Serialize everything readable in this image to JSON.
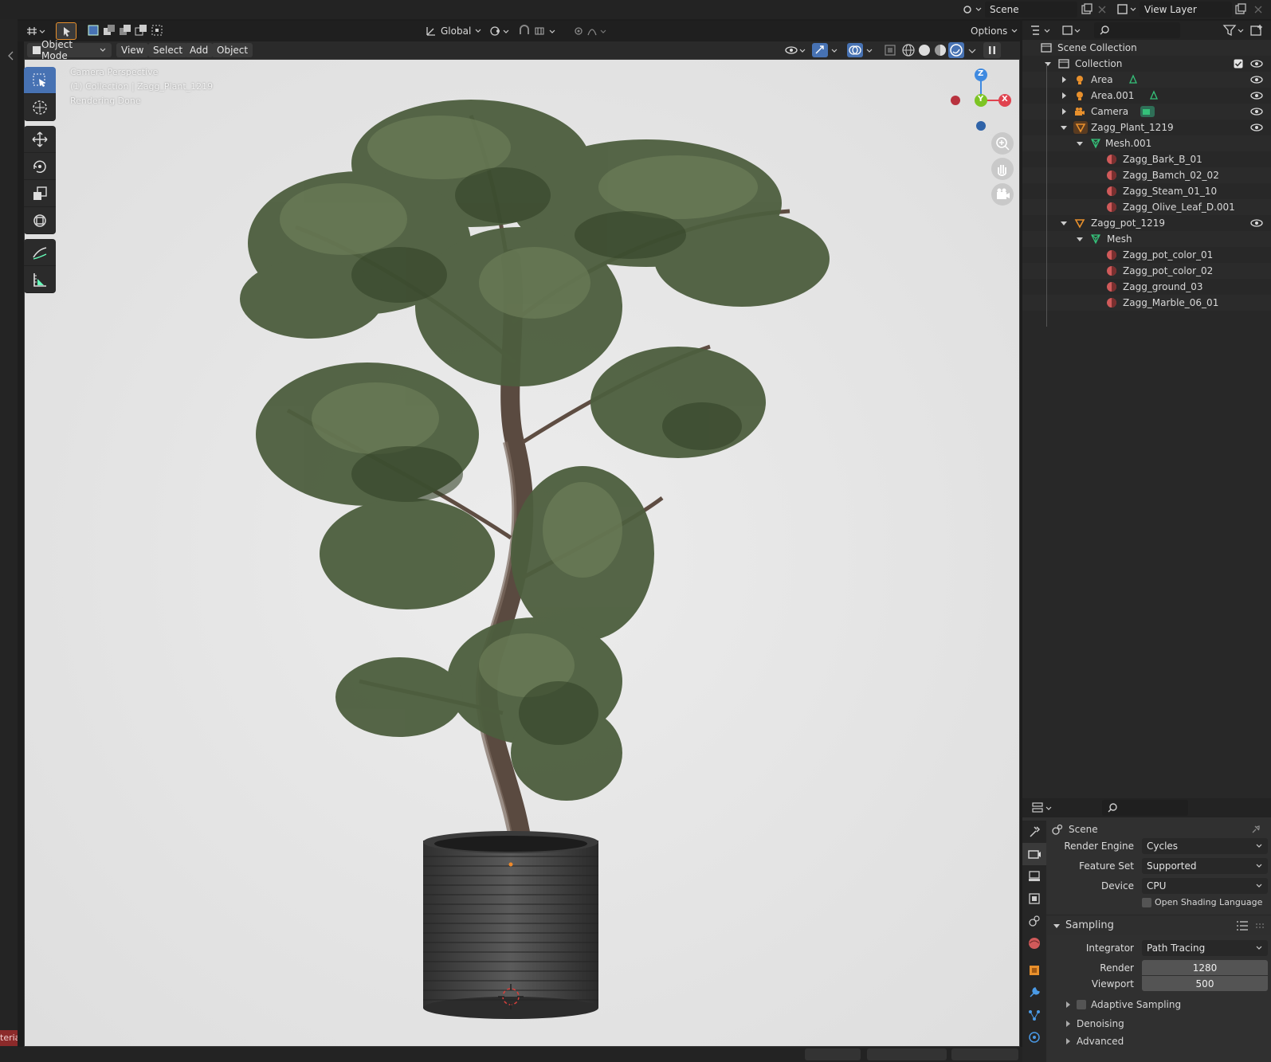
{
  "topbar": {
    "scene_label": "Scene",
    "view_layer_label": "View Layer"
  },
  "viewport_header": {
    "orientation": "Global",
    "options_label": "Options"
  },
  "viewport_menu": {
    "mode": "Object Mode",
    "view": "View",
    "select": "Select",
    "add": "Add",
    "object": "Object"
  },
  "viewport_overlay": {
    "line1": "Camera Perspective",
    "line2": "(1) Collection | Zagg_Plant_1219",
    "line3": "Rendering Done"
  },
  "gizmo": {
    "z": "Z",
    "y": "Y",
    "x": "X"
  },
  "outliner": {
    "root": "Scene Collection",
    "rows": [
      {
        "label": "Collection"
      },
      {
        "label": "Area"
      },
      {
        "label": "Area.001"
      },
      {
        "label": "Camera"
      },
      {
        "label": "Zagg_Plant_1219"
      },
      {
        "label": "Mesh.001"
      },
      {
        "label": "Zagg_Bark_B_01"
      },
      {
        "label": "Zagg_Bamch_02_02"
      },
      {
        "label": "Zagg_Steam_01_10"
      },
      {
        "label": "Zagg_Olive_Leaf_D.001"
      },
      {
        "label": "Zagg_pot_1219"
      },
      {
        "label": "Mesh"
      },
      {
        "label": "Zagg_pot_color_01"
      },
      {
        "label": "Zagg_pot_color_02"
      },
      {
        "label": "Zagg_ground_03"
      },
      {
        "label": "Zagg_Marble_06_01"
      }
    ]
  },
  "properties": {
    "context": "Scene",
    "render_engine_label": "Render Engine",
    "render_engine": "Cycles",
    "feature_set_label": "Feature Set",
    "feature_set": "Supported",
    "device_label": "Device",
    "device": "CPU",
    "osl_label": "Open Shading Language",
    "sampling_label": "Sampling",
    "integrator_label": "Integrator",
    "integrator": "Path Tracing",
    "render_label": "Render",
    "render_value": "1280",
    "viewport_label": "Viewport",
    "viewport_value": "500",
    "adaptive_label": "Adaptive Sampling",
    "denoising_label": "Denoising",
    "advanced_label": "Advanced"
  },
  "side_tab": "teria",
  "colors": {
    "accent": "#4772b3",
    "x_axis": "#e0434f",
    "y_axis": "#7dc424",
    "z_axis": "#3f8ae0",
    "object_orange": "#e8902c",
    "material_red": "#d05a5a",
    "mesh_green": "#35c27a"
  }
}
